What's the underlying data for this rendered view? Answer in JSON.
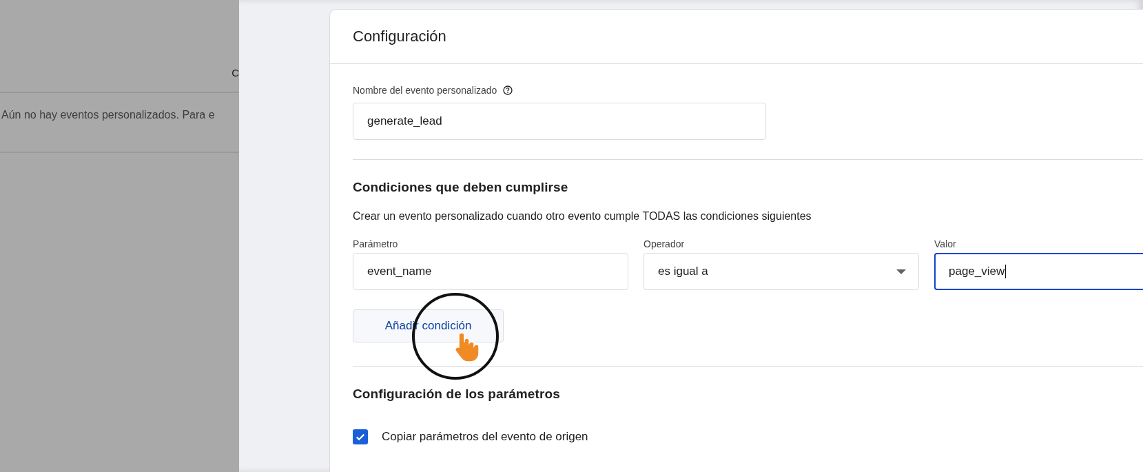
{
  "background_page": {
    "column_header": "C",
    "empty_message": "Aún no hay eventos personalizados. Para e"
  },
  "panel": {
    "title": "Configuración",
    "event_name": {
      "label": "Nombre del evento personalizado",
      "value": "generate_lead"
    },
    "conditions": {
      "heading": "Condiciones que deben cumplirse",
      "description": "Crear un evento personalizado cuando otro evento cumple TODAS las condiciones siguientes",
      "fields": [
        {
          "kind": "text",
          "label": "Parámetro",
          "value": "event_name",
          "focused": false
        },
        {
          "kind": "dropdown",
          "label": "Operador",
          "value": "es igual a",
          "focused": false
        },
        {
          "kind": "text",
          "label": "Valor",
          "value": "page_view",
          "focused": true
        }
      ],
      "add_button": "Añadir condición"
    },
    "parameters": {
      "heading": "Configuración de los parámetros",
      "options": [
        {
          "label": "Copiar parámetros del evento de origen",
          "checked": true
        }
      ]
    }
  }
}
